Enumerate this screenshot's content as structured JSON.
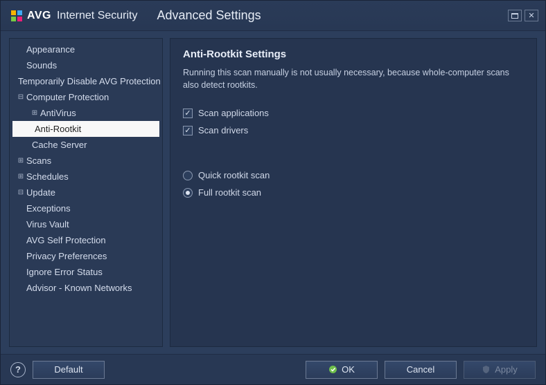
{
  "titlebar": {
    "brand_text": "AVG",
    "brand_sub": "Internet Security",
    "section": "Advanced Settings"
  },
  "sidebar": {
    "items": [
      {
        "label": "Appearance",
        "level": 0,
        "expander": ""
      },
      {
        "label": "Sounds",
        "level": 0,
        "expander": ""
      },
      {
        "label": "Temporarily Disable AVG Protection",
        "level": 0,
        "expander": ""
      },
      {
        "label": "Computer Protection",
        "level": 0,
        "expander": "⊟"
      },
      {
        "label": "AntiVirus",
        "level": 1,
        "expander": "⊞"
      },
      {
        "label": "Anti-Rootkit",
        "level": 1,
        "expander": "",
        "selected": true
      },
      {
        "label": "Cache Server",
        "level": 1,
        "expander": ""
      },
      {
        "label": "Scans",
        "level": 0,
        "expander": "⊞"
      },
      {
        "label": "Schedules",
        "level": 0,
        "expander": "⊞"
      },
      {
        "label": "Update",
        "level": 0,
        "expander": "⊟"
      },
      {
        "label": "Exceptions",
        "level": 0,
        "expander": ""
      },
      {
        "label": "Virus Vault",
        "level": 0,
        "expander": ""
      },
      {
        "label": "AVG Self Protection",
        "level": 0,
        "expander": ""
      },
      {
        "label": "Privacy Preferences",
        "level": 0,
        "expander": ""
      },
      {
        "label": "Ignore Error Status",
        "level": 0,
        "expander": ""
      },
      {
        "label": "Advisor - Known Networks",
        "level": 0,
        "expander": ""
      }
    ]
  },
  "content": {
    "heading": "Anti-Rootkit Settings",
    "description": "Running this scan manually is not usually necessary, because whole-computer scans also detect rootkits.",
    "checkboxes": [
      {
        "label": "Scan applications",
        "checked": true
      },
      {
        "label": "Scan drivers",
        "checked": true
      }
    ],
    "radios": [
      {
        "label": "Quick rootkit scan",
        "selected": false
      },
      {
        "label": "Full rootkit scan",
        "selected": true
      }
    ]
  },
  "footer": {
    "default_label": "Default",
    "ok_label": "OK",
    "cancel_label": "Cancel",
    "apply_label": "Apply"
  }
}
